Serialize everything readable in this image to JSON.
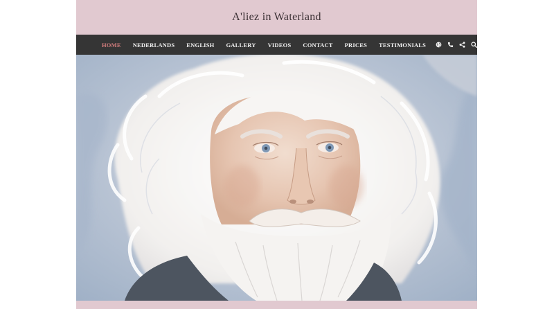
{
  "site": {
    "title": "A'liez in Waterland"
  },
  "nav": {
    "items": [
      {
        "label": "HOME",
        "active": true
      },
      {
        "label": "NEDERLANDS",
        "active": false
      },
      {
        "label": "ENGLISH",
        "active": false
      },
      {
        "label": "GALLERY",
        "active": false
      },
      {
        "label": "VIDEOS",
        "active": false
      },
      {
        "label": "CONTACT",
        "active": false
      },
      {
        "label": "PRICES",
        "active": false
      },
      {
        "label": "TESTIMONIALS",
        "active": false
      }
    ],
    "icons": [
      "globe-icon",
      "phone-icon",
      "share-icon",
      "search-icon"
    ],
    "active_color": "#d77f7f"
  },
  "hero": {
    "image": "watercolor-portrait",
    "description": "Watercolor portrait of an elderly man with wild white hair and a full white beard on a blue-grey wash background"
  },
  "colors": {
    "header_bg": "#e1c9d0",
    "nav_bg": "#353535",
    "text": "#3a2f33"
  }
}
